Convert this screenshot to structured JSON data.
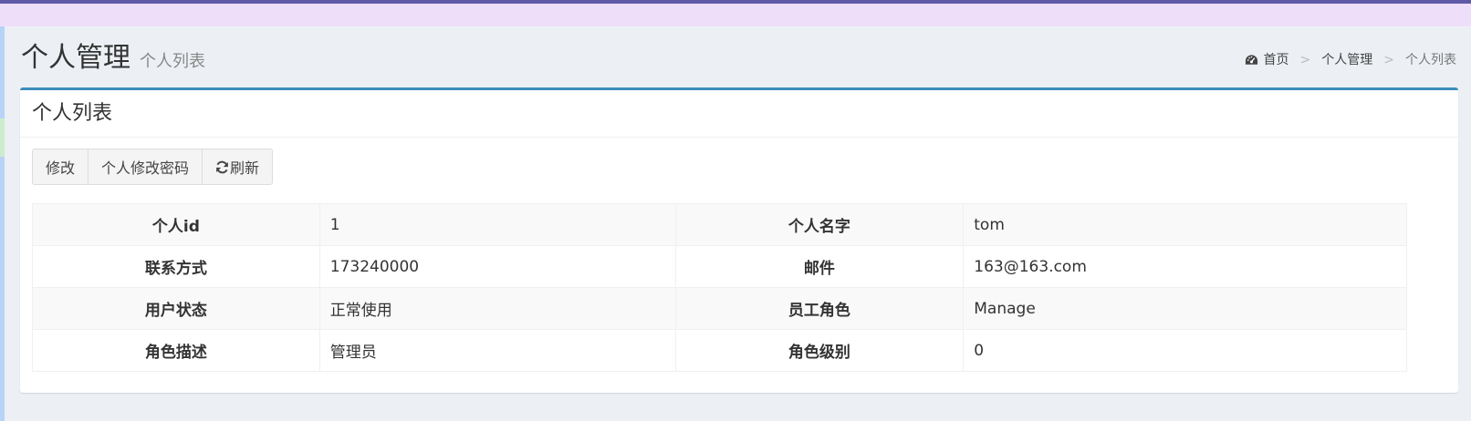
{
  "colors": {
    "topbar": "#efdefa",
    "topbar_line": "#5f5aa8",
    "box_border": "#3c8dbc",
    "page_bg": "#ecf0f5"
  },
  "header": {
    "title": "个人管理",
    "subtitle": "个人列表"
  },
  "breadcrumb": {
    "icon": "dashboard-icon",
    "items": [
      "首页",
      "个人管理",
      "个人列表"
    ],
    "separator": ">"
  },
  "box": {
    "title": "个人列表"
  },
  "toolbar": {
    "edit_label": "修改",
    "change_password_label": "个人修改密码",
    "refresh_icon": "refresh-icon",
    "refresh_label": "刷新"
  },
  "details": {
    "rows": [
      [
        {
          "label": "个人id",
          "value": "1"
        },
        {
          "label": "个人名字",
          "value": "tom"
        }
      ],
      [
        {
          "label": "联系方式",
          "value": "173240000"
        },
        {
          "label": "邮件",
          "value": "163@163.com"
        }
      ],
      [
        {
          "label": "用户状态",
          "value": "正常使用"
        },
        {
          "label": "员工角色",
          "value": "Manage"
        }
      ],
      [
        {
          "label": "角色描述",
          "value": "管理员"
        },
        {
          "label": "角色级别",
          "value": "0"
        }
      ]
    ]
  }
}
